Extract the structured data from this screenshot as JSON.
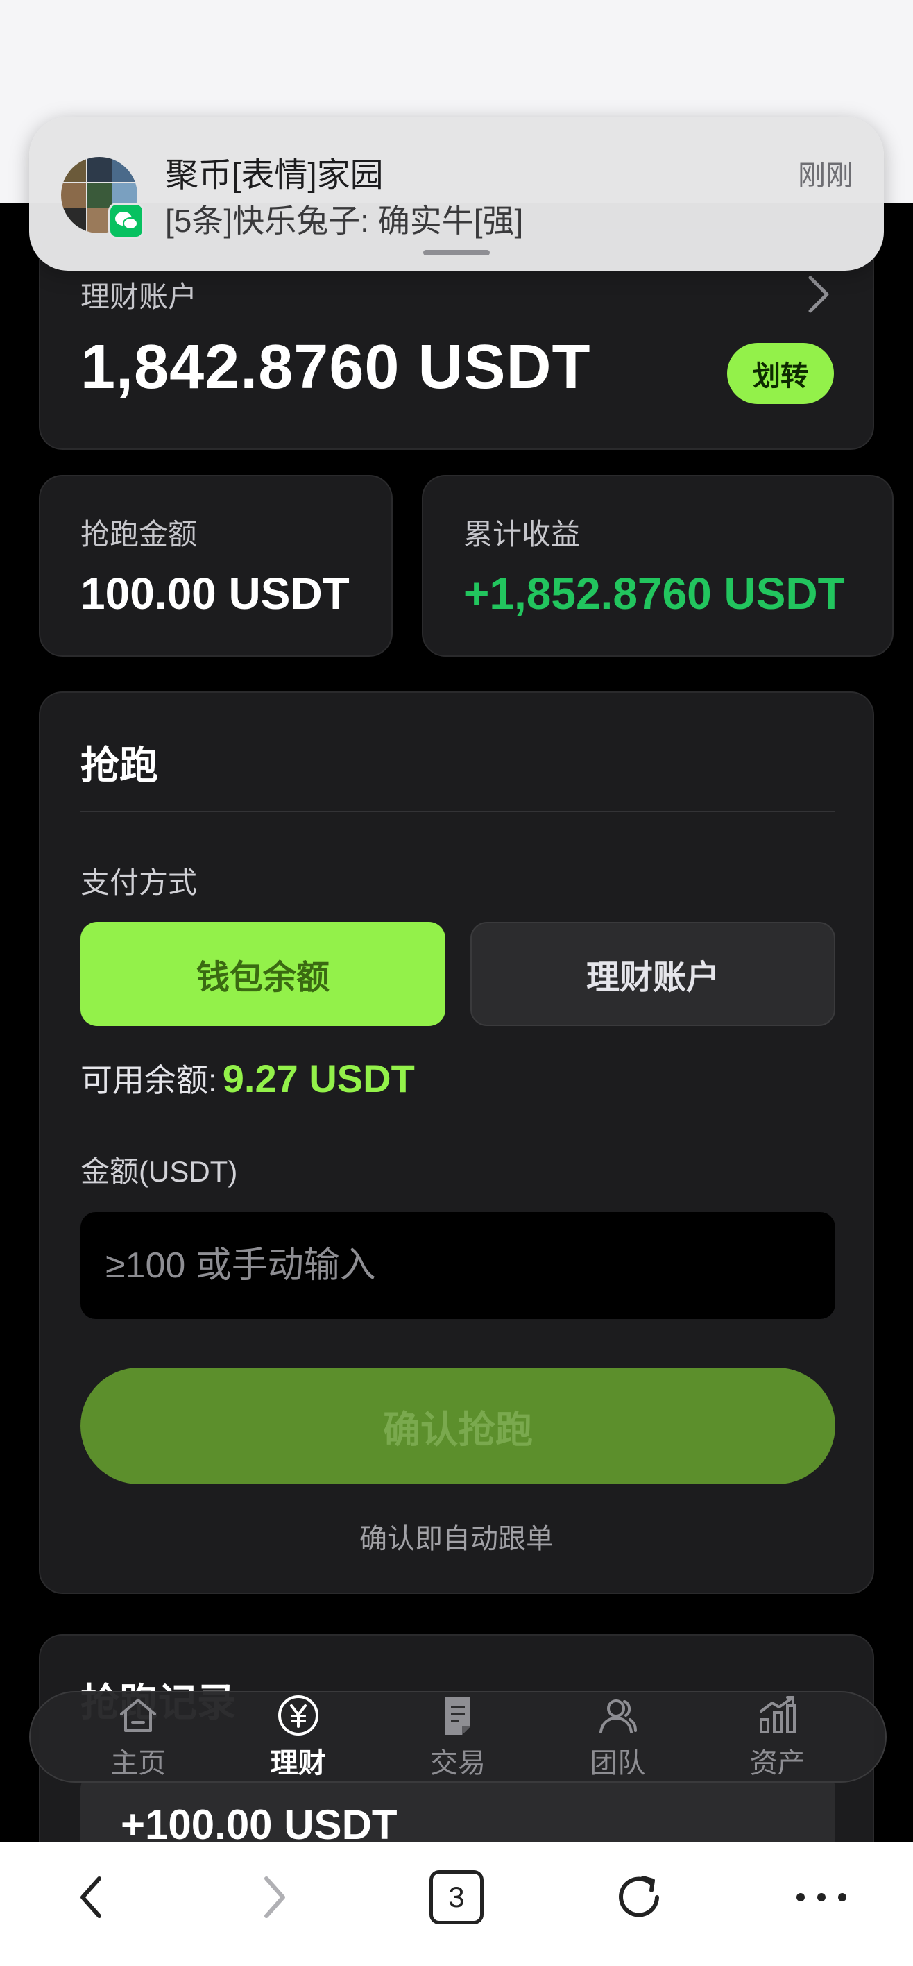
{
  "notification": {
    "title": "聚币[表情]家园",
    "message": "[5条]快乐兔子: 确实牛[强]",
    "time": "刚刚"
  },
  "account": {
    "label": "理财账户",
    "balance": "1,842.8760 USDT",
    "transfer_label": "划转"
  },
  "stats": {
    "amount_label": "抢跑金额",
    "amount_value": "100.00 USDT",
    "income_label": "累计收益",
    "income_value": "+1,852.8760 USDT"
  },
  "grab": {
    "title": "抢跑",
    "pay_method_label": "支付方式",
    "pay_options": [
      "钱包余额",
      "理财账户"
    ],
    "available_label": "可用余额:",
    "available_value": "9.27 USDT",
    "amount_label": "金额(USDT)",
    "amount_placeholder": "≥100 或手动输入",
    "confirm_label": "确认抢跑",
    "note": "确认即自动跟单"
  },
  "record": {
    "title": "抢跑记录",
    "amount": "+100.00 USDT"
  },
  "tabs": [
    {
      "label": "主页",
      "icon": "home-icon"
    },
    {
      "label": "理财",
      "icon": "yuan-icon",
      "active": true
    },
    {
      "label": "交易",
      "icon": "document-icon"
    },
    {
      "label": "团队",
      "icon": "users-icon"
    },
    {
      "label": "资产",
      "icon": "chart-icon"
    }
  ],
  "browser": {
    "tab_count": "3"
  },
  "colors": {
    "accent": "#93f14a",
    "income": "#22c55e",
    "card": "#1c1c1e"
  }
}
